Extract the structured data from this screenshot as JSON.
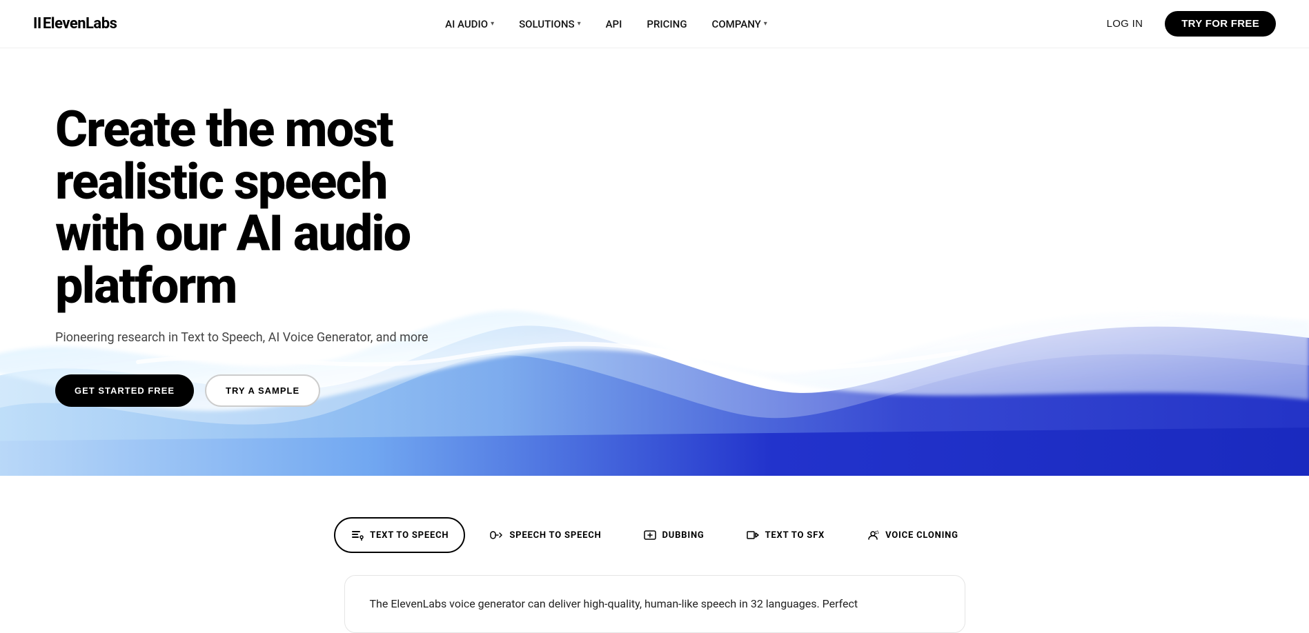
{
  "brand": {
    "name": "ElevenLabs",
    "logo_prefix": "II"
  },
  "nav": {
    "items": [
      {
        "id": "ai-audio",
        "label": "AI AUDIO",
        "has_dropdown": true
      },
      {
        "id": "solutions",
        "label": "SOLUTIONS",
        "has_dropdown": true
      },
      {
        "id": "api",
        "label": "API",
        "has_dropdown": false
      },
      {
        "id": "pricing",
        "label": "PRICING",
        "has_dropdown": false
      },
      {
        "id": "company",
        "label": "COMPANY",
        "has_dropdown": true
      }
    ],
    "login_label": "LOG IN",
    "try_free_label": "TRY FOR FREE"
  },
  "hero": {
    "title_line1": "Create the most realistic speech",
    "title_line2": "with our AI audio platform",
    "subtitle": "Pioneering research in Text to Speech, AI Voice Generator, and more",
    "btn_get_started": "GET STARTED FREE",
    "btn_try_sample": "TRY A SAMPLE"
  },
  "tabs": [
    {
      "id": "text-to-speech",
      "label": "TEXT TO SPEECH",
      "active": true,
      "icon": "tts-icon"
    },
    {
      "id": "speech-to-speech",
      "label": "SPEECH TO SPEECH",
      "active": false,
      "icon": "sts-icon"
    },
    {
      "id": "dubbing",
      "label": "DUBBING",
      "active": false,
      "icon": "dub-icon"
    },
    {
      "id": "text-to-sfx",
      "label": "TEXT TO SFX",
      "active": false,
      "icon": "sfx-icon"
    },
    {
      "id": "voice-cloning",
      "label": "VOICE CLONING",
      "active": false,
      "icon": "vc-icon"
    }
  ],
  "description": {
    "text": "The ElevenLabs voice generator can deliver high-quality, human-like speech in 32 languages. Perfect"
  },
  "colors": {
    "primary": "#000000",
    "secondary": "#ffffff",
    "accent_blue": "#3b4dd4",
    "wave_blue_dark": "#2233cc",
    "wave_blue_light": "#a8d0f5"
  }
}
